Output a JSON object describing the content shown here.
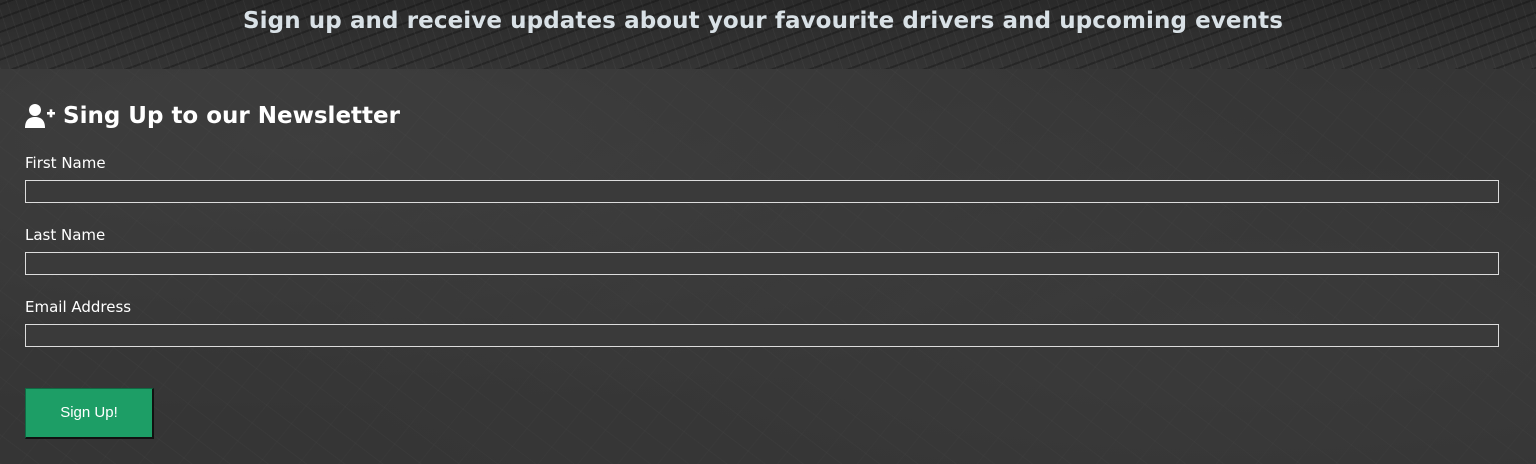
{
  "banner": {
    "text": "Sign up and receive updates about your favourite drivers and upcoming events"
  },
  "newsletter": {
    "heading_icon": "user-plus-icon",
    "heading": "Sing Up to our Newsletter",
    "fields": [
      {
        "label": "First Name",
        "value": "",
        "placeholder": ""
      },
      {
        "label": "Last Name",
        "value": "",
        "placeholder": ""
      },
      {
        "label": "Email Address",
        "value": "",
        "placeholder": ""
      }
    ],
    "submit_label": "Sign Up!"
  },
  "colors": {
    "background": "#2f2f2f",
    "banner_text": "#d9e1e6",
    "button": "#1d9e66",
    "text": "#ffffff"
  }
}
